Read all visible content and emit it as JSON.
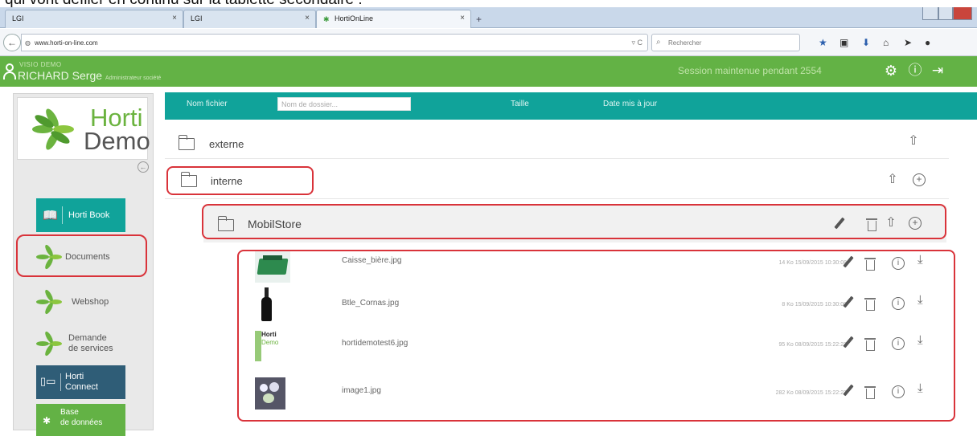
{
  "caption_fragment": "qui vont défiler en continu sur la tablette secondaire :",
  "browser": {
    "tabs": [
      {
        "label": "LGI",
        "close": "×"
      },
      {
        "label": "LGI",
        "close": "×"
      },
      {
        "label": "HortiOnLine",
        "close": "×"
      }
    ],
    "new_tab": "+",
    "url": "www.horti-on-line.com",
    "url_reload": "▿ C",
    "search_placeholder": "Rechercher"
  },
  "header": {
    "org": "VISIO DEMO",
    "user_name": "RICHARD Serge",
    "user_role": "Administrateur société",
    "session": "Session maintenue pendant 2554",
    "icons": [
      "gear-icon",
      "info-icon",
      "logout-icon"
    ]
  },
  "sidebar": {
    "logo_top": "Horti",
    "logo_bottom": "Demo",
    "items": [
      {
        "label": "Horti Book"
      },
      {
        "label": "Documents"
      },
      {
        "label": "Webshop"
      },
      {
        "label_line1": "Demande",
        "label_line2": "de services"
      },
      {
        "label_line1": "Horti",
        "label_line2": "Connect"
      },
      {
        "label_line1": "Base",
        "label_line2": "de données"
      }
    ]
  },
  "table": {
    "col_name": "Nom fichier",
    "filter_placeholder": "Nom de dossier...",
    "col_size": "Taille",
    "col_date": "Date mis à jour"
  },
  "folders": [
    {
      "name": "externe"
    },
    {
      "name": "interne"
    },
    {
      "name": "MobilStore"
    }
  ],
  "files": [
    {
      "name": "Caisse_bière.jpg",
      "meta": "14 Ko 15/09/2015 10:30:08"
    },
    {
      "name": "Btle_Cornas.jpg",
      "meta": "8 Ko 15/09/2015 10:30:00"
    },
    {
      "name": "hortidemotest6.jpg",
      "meta": "95 Ko 08/09/2015 15:22:22"
    },
    {
      "name": "image1.jpg",
      "meta": "282 Ko 08/09/2015 15:22:22"
    }
  ],
  "thumb3": {
    "line1": "Horti",
    "line2": "Demo"
  }
}
